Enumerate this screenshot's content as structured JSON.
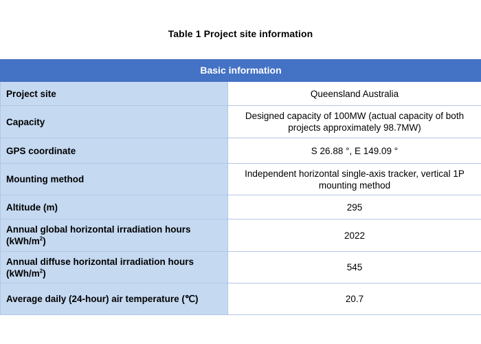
{
  "caption": "Table 1 Project site information",
  "table": {
    "header": "Basic information",
    "rows": [
      {
        "label": "Project site",
        "value": "Queensland Australia"
      },
      {
        "label": "Capacity",
        "value": "Designed capacity of 100MW (actual capacity of both projects approximately 98.7MW)"
      },
      {
        "label": "GPS coordinate",
        "value": "S 26.88 °, E 149.09 °"
      },
      {
        "label": "Mounting method",
        "value": "Independent horizontal single-axis tracker, vertical 1P mounting method"
      },
      {
        "label": "Altitude (m)",
        "value": "295"
      },
      {
        "label": "Annual global horizontal irradiation hours (kWh/m",
        "label_sup": "2",
        "label_end": ")",
        "value": "2022"
      },
      {
        "label": "Annual diffuse horizontal irradiation hours (kWh/m",
        "label_sup": "2",
        "label_end": ")",
        "value": "545"
      },
      {
        "label": "Average daily (24-hour) air temperature (℃)",
        "value": "20.7"
      }
    ]
  },
  "colors": {
    "header_bg": "#4472c4",
    "label_bg": "#c5d9f1",
    "border": "#b4c6e7"
  }
}
